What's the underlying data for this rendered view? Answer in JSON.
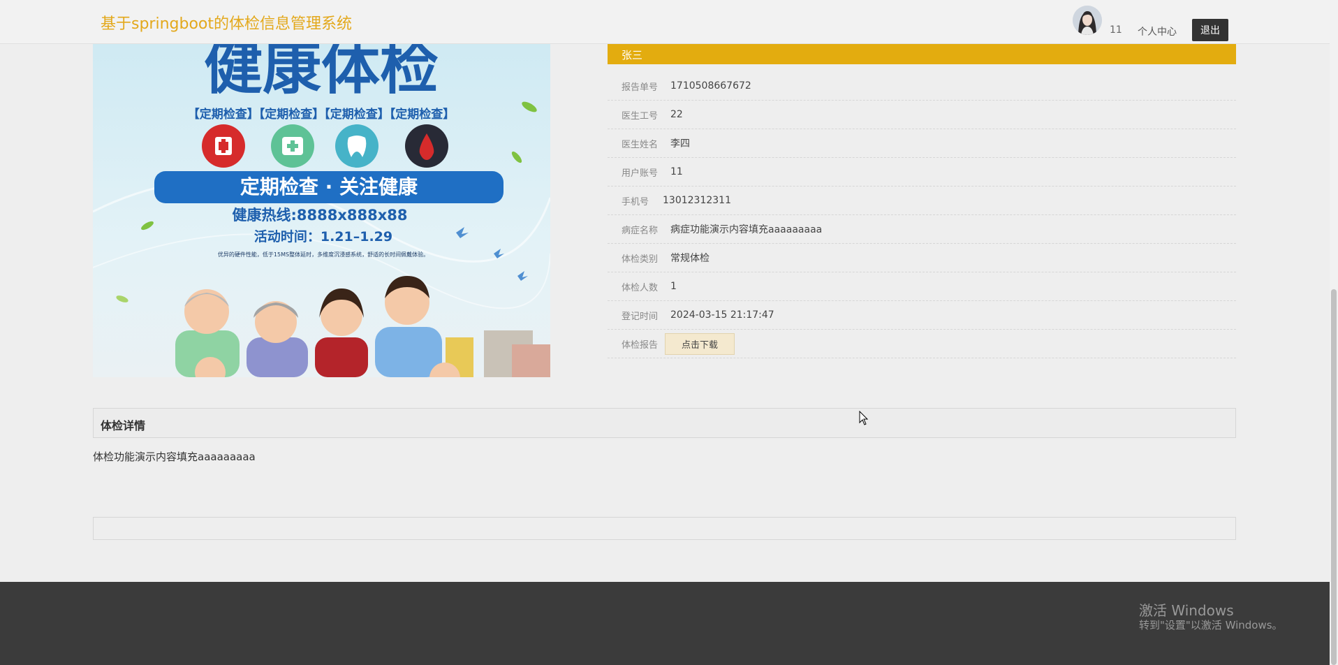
{
  "header": {
    "site_title": "基于springboot的体检信息管理系统",
    "username": "11",
    "personal_center": "个人中心",
    "logout": "退出"
  },
  "poster": {
    "headline": "健康体检",
    "tags": "【定期检查】【定期检查】【定期检查】【定期检查】",
    "banner": "定期检查 · 关注健康",
    "hotline": "健康热线:8888x888x88",
    "activity_time": "活动时间：1.21–1.29",
    "small_print": "优异的硬件性能，低于15MS整体延时，多维度沉浸感系统，舒适的长时间佩戴体验。"
  },
  "record": {
    "name": "张三",
    "rows": [
      {
        "label": "报告单号",
        "value": "1710508667672"
      },
      {
        "label": "医生工号",
        "value": "22"
      },
      {
        "label": "医生姓名",
        "value": "李四"
      },
      {
        "label": "用户账号",
        "value": "11"
      },
      {
        "label": "手机号",
        "value": "13012312311"
      },
      {
        "label": "病症名称",
        "value": "病症功能演示内容填充aaaaaaaaa"
      },
      {
        "label": "体检类别",
        "value": "常规体检"
      },
      {
        "label": "体检人数",
        "value": "1"
      },
      {
        "label": "登记时间",
        "value": "2024-03-15 21:17:47"
      }
    ],
    "report_label": "体检报告",
    "download": "点击下载"
  },
  "details": {
    "title": "体检详情",
    "content": "体检功能演示内容填充aaaaaaaaa"
  },
  "watermark": {
    "title": "激活 Windows",
    "subtitle": "转到\"设置\"以激活 Windows。"
  }
}
